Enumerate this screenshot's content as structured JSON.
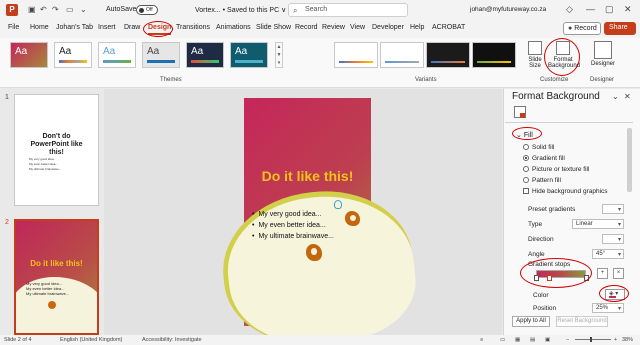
{
  "titlebar": {
    "app_letter": "P",
    "autosave_label": "AutoSave",
    "autosave_state": "Off",
    "doc_title": "Vortex... • Saved to this PC ∨",
    "search_placeholder": "Search",
    "account": "johan@myfutureway.co.za"
  },
  "tabs": [
    "File",
    "Home",
    "Johan's Tab",
    "Insert",
    "Draw",
    "Design",
    "Transitions",
    "Animations",
    "Slide Show",
    "Record",
    "Review",
    "View",
    "Developer",
    "Help",
    "ACROBAT"
  ],
  "active_tab": "Design",
  "buttons": {
    "record": "Record",
    "share": "Share"
  },
  "ribbon": {
    "themes_label": "Themes",
    "variants_label": "Variants",
    "customize_label": "Customize",
    "designer_group_label": "Designer",
    "theme_glyph": "Aa",
    "slide_size": "Slide Size",
    "format_background": "Format Background",
    "designer": "Designer"
  },
  "thumbnails": {
    "slide1_num": "1",
    "slide1_title": "Don't do PowerPoint like this!",
    "slide1_bullets": [
      "My very good idea...",
      "My even better idea...",
      "My ultimate brainwave..."
    ],
    "slide2_num": "2",
    "slide2_title": "Do it like this!",
    "slide2_bullets": [
      "My very good idea...",
      "My even better idea...",
      "My ultimate brainwave..."
    ]
  },
  "slide": {
    "title": "Do it like this!",
    "bullets": [
      "My very good idea...",
      "My even better idea...",
      "My ultimate brainwave..."
    ]
  },
  "pane": {
    "title": "Format Background",
    "fill_section": "Fill",
    "options": [
      "Solid fill",
      "Gradient fill",
      "Picture or texture fill",
      "Pattern fill"
    ],
    "selected_option": "Gradient fill",
    "hide_graphics": "Hide background graphics",
    "preset_gradients": "Preset gradients",
    "type_label": "Type",
    "type_value": "Linear",
    "direction_label": "Direction",
    "angle_label": "Angle",
    "angle_value": "45°",
    "gradient_stops": "Gradient stops",
    "color_label": "Color",
    "position_label": "Position",
    "position_value": "25%",
    "apply_all": "Apply to All",
    "reset": "Reset Background"
  },
  "status": {
    "slide_info": "Slide 2 of 4",
    "language": "English (United Kingdom)",
    "accessibility": "Accessibility: Investigate",
    "zoom": "38%"
  },
  "colors": {
    "accent": "#c43e1c",
    "slide_grad_start": "#c5265b",
    "slide_grad_end": "#a7883b",
    "title_yellow": "#f4c21a",
    "annotation_red": "#d10000"
  }
}
